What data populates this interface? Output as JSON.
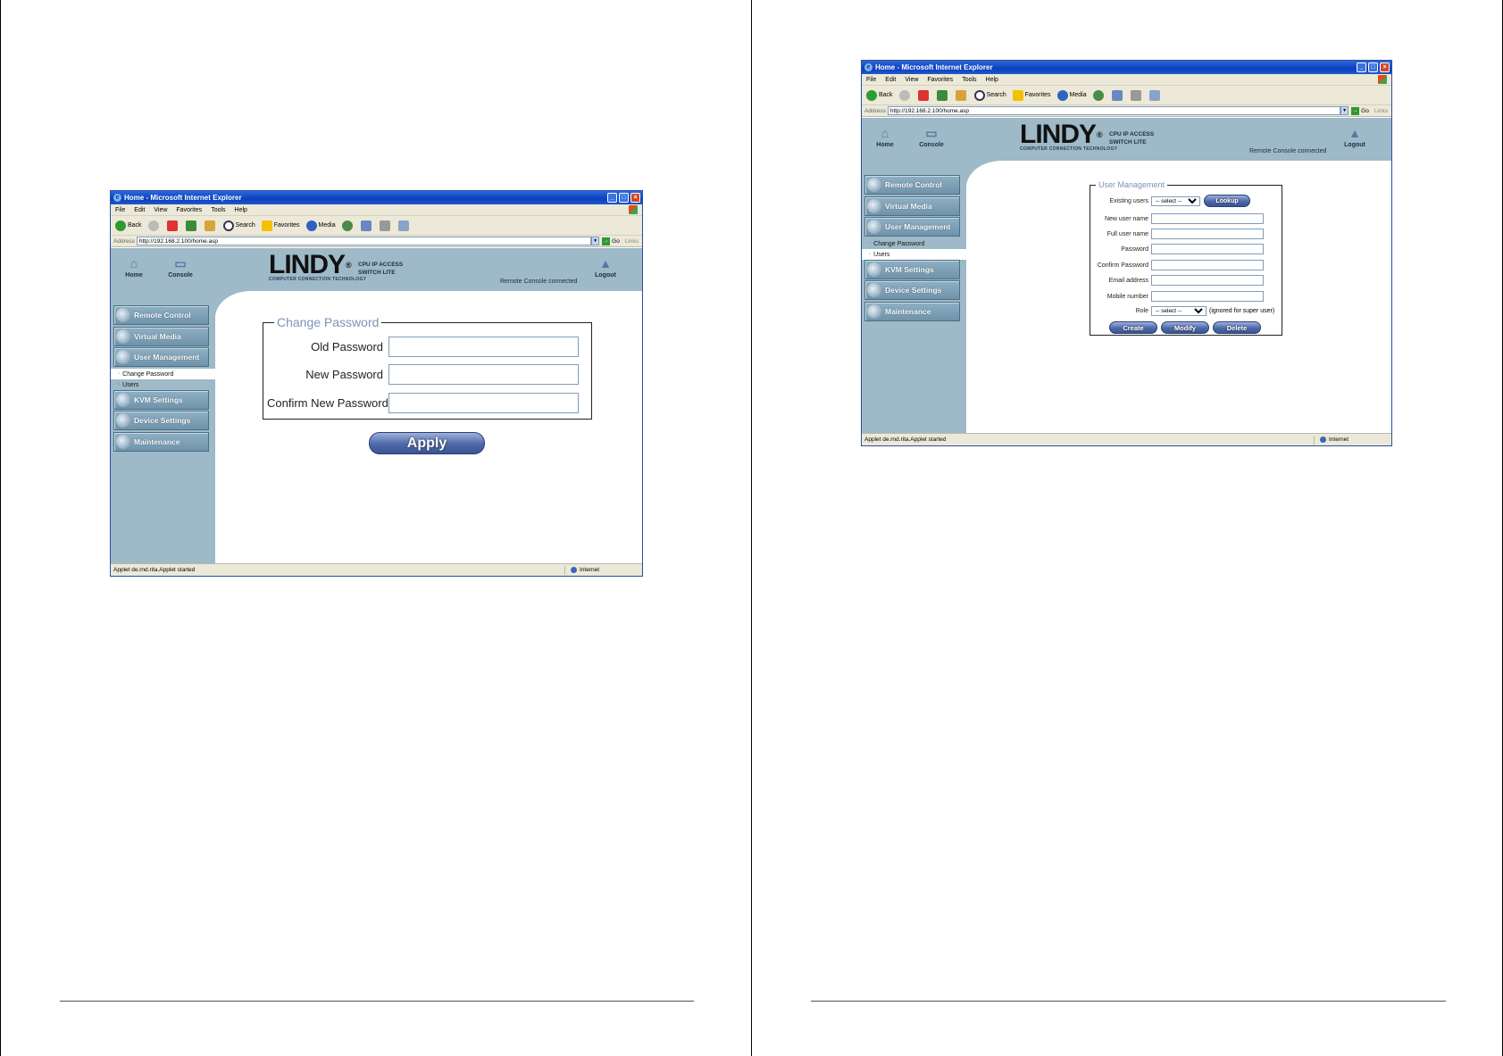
{
  "left_screenshot": {
    "window_title": "Home - Microsoft Internet Explorer",
    "menu": [
      "File",
      "Edit",
      "View",
      "Favorites",
      "Tools",
      "Help"
    ],
    "toolbar": {
      "back": "Back",
      "search": "Search",
      "favorites": "Favorites",
      "media": "Media"
    },
    "address_label": "Address",
    "address_url": "http://192.168.2.100/home.asp",
    "go_label": "Go",
    "links_label": "Links",
    "header": {
      "home": "Home",
      "console": "Console",
      "logo": "LINDY",
      "logo_sub": "COMPUTER CONNECTION TECHNOLOGY",
      "product_line1": "CPU IP ACCESS",
      "product_line2": "SWITCH LITE",
      "remote_status": "Remote Console connected",
      "logout": "Logout"
    },
    "nav": {
      "remote_control": "Remote Control",
      "virtual_media": "Virtual Media",
      "user_management": "User Management",
      "change_password": "Change Password",
      "users": "Users",
      "kvm_settings": "KVM Settings",
      "device_settings": "Device Settings",
      "maintenance": "Maintenance"
    },
    "form": {
      "legend": "Change Password",
      "old_password": "Old Password",
      "new_password": "New Password",
      "confirm_new_password": "Confirm New Password",
      "apply": "Apply"
    },
    "status_text": "Applet de.rnd.rita.Applet started",
    "zone": "Internet"
  },
  "right_screenshot": {
    "window_title": "Home - Microsoft Internet Explorer",
    "menu": [
      "File",
      "Edit",
      "View",
      "Favorites",
      "Tools",
      "Help"
    ],
    "toolbar": {
      "back": "Back",
      "search": "Search",
      "favorites": "Favorites",
      "media": "Media"
    },
    "address_label": "Address",
    "address_url": "http://192.168.2.100/home.asp",
    "go_label": "Go",
    "links_label": "Links",
    "header": {
      "home": "Home",
      "console": "Console",
      "logo": "LINDY",
      "logo_sub": "COMPUTER CONNECTION TECHNOLOGY",
      "product_line1": "CPU IP ACCESS",
      "product_line2": "SWITCH LITE",
      "remote_status": "Remote Console connected",
      "logout": "Logout"
    },
    "nav": {
      "remote_control": "Remote Control",
      "virtual_media": "Virtual Media",
      "user_management": "User Management",
      "change_password": "Change Password",
      "users": "Users",
      "kvm_settings": "KVM Settings",
      "device_settings": "Device Settings",
      "maintenance": "Maintenance"
    },
    "form": {
      "legend": "User Management",
      "existing_users": "Existing users",
      "select_placeholder": "-- select --",
      "lookup": "Lookup",
      "new_user_name": "New user name",
      "full_user_name": "Full user name",
      "password": "Password",
      "confirm_password": "Confirm Password",
      "email_address": "Email address",
      "mobile_number": "Mobile number",
      "role": "Role",
      "role_note": "(ignored for super user)",
      "create": "Create",
      "modify": "Modify",
      "delete": "Delete"
    },
    "status_text": "Applet de.rnd.rita.Applet started",
    "zone": "Internet"
  }
}
